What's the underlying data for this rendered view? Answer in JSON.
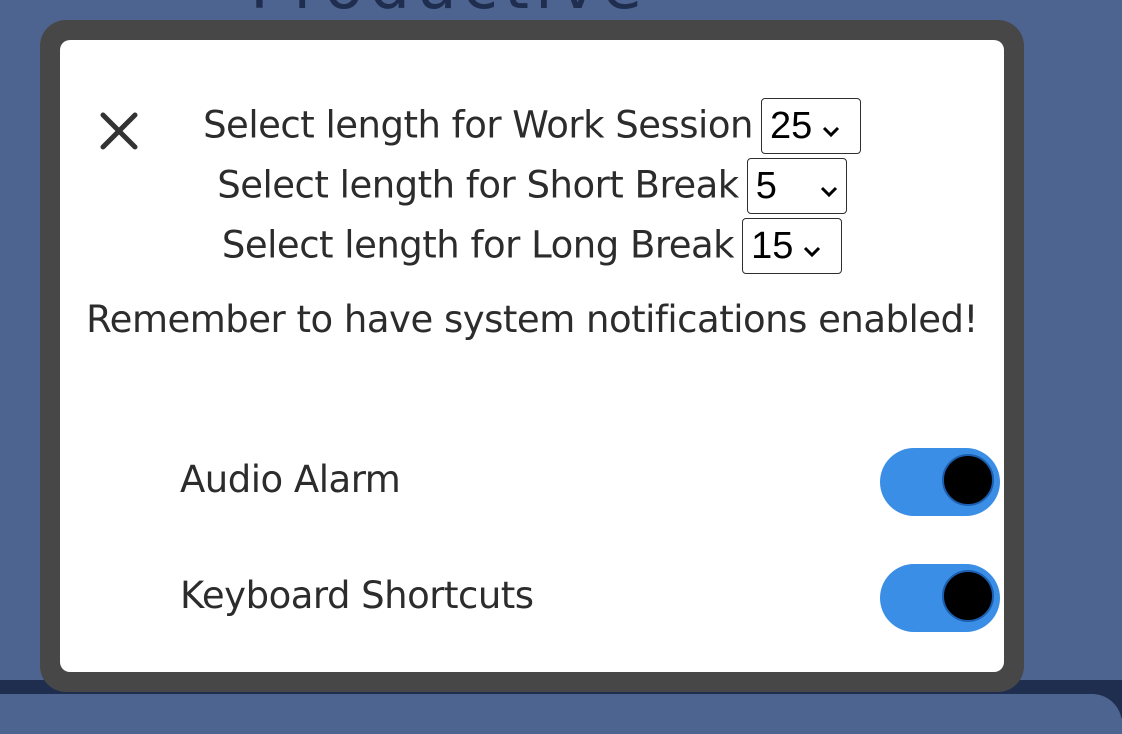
{
  "background": {
    "title": "Productive",
    "colors": {
      "page": "#4d6490",
      "dark": "#1f2d4f"
    }
  },
  "modal": {
    "close_icon": "close-icon",
    "session_settings": [
      {
        "label": "Select length for Work Session",
        "value": "25"
      },
      {
        "label": "Select length for Short Break",
        "value": "5"
      },
      {
        "label": "Select length for Long Break",
        "value": "15"
      }
    ],
    "notice": "Remember to have system notifications enabled!",
    "toggles": [
      {
        "label": "Audio Alarm",
        "state": "on"
      },
      {
        "label": "Keyboard Shortcuts",
        "state": "on"
      }
    ],
    "colors": {
      "frame": "#474747",
      "toggle_on": "#3a8ee6",
      "knob": "#000000"
    }
  }
}
